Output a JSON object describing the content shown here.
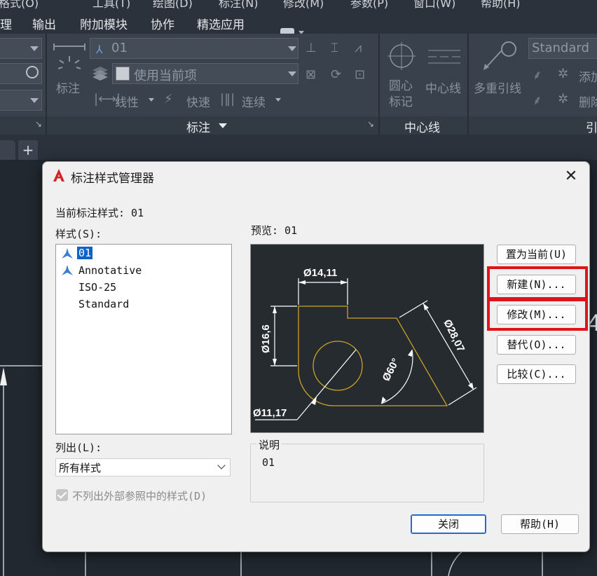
{
  "menubar": {
    "items": [
      "格式(O)",
      "工具(T)",
      "绘图(D)",
      "标注(N)",
      "修改(M)",
      "参数(P)",
      "窗口(W)",
      "帮助(H)"
    ]
  },
  "ribbon": {
    "tabs": [
      "理",
      "输出",
      "附加模块",
      "协作",
      "精选应用"
    ],
    "dim_panel": {
      "title": "标注",
      "big_label": "标注",
      "dim_style_value": "01",
      "layer_value": "使用当前项",
      "row3": [
        "线性",
        "快速",
        "连续"
      ]
    },
    "center_panel": {
      "title": "中心线",
      "center_mark": "圆心\n标记",
      "centerline": "中心线"
    },
    "leader_panel": {
      "title": "引",
      "multileader": "多重引线",
      "style_value": "Standard",
      "add": "添加",
      "remove": "删除"
    }
  },
  "dialog": {
    "title": "标注样式管理器",
    "close": "✕",
    "current_style_label": "当前标注样式: 01",
    "styles_label": "样式(S):",
    "styles": [
      "01",
      "Annotative",
      "ISO-25",
      "Standard"
    ],
    "preview_label": "预览: 01",
    "list_label": "列出(L):",
    "list_value": "所有样式",
    "exclude_xref_label": "不列出外部参照中的样式(D)",
    "description_label": "说明",
    "description_value": "01",
    "buttons": {
      "set_current": "置为当前(U)",
      "new": "新建(N)...",
      "modify": "修改(M)...",
      "override": "替代(O)...",
      "compare": "比较(C)...",
      "close": "关闭",
      "help": "帮助(H)"
    },
    "preview_dims": {
      "top": "Ø14,11",
      "left": "Ø16,6",
      "right": "Ø28,07",
      "angle": "Ø60°",
      "bottom": "Ø11,17"
    }
  },
  "colors": {
    "highlight": "#e0131b",
    "preview_geometry": "#c9a227",
    "selection": "#0a64c8"
  }
}
